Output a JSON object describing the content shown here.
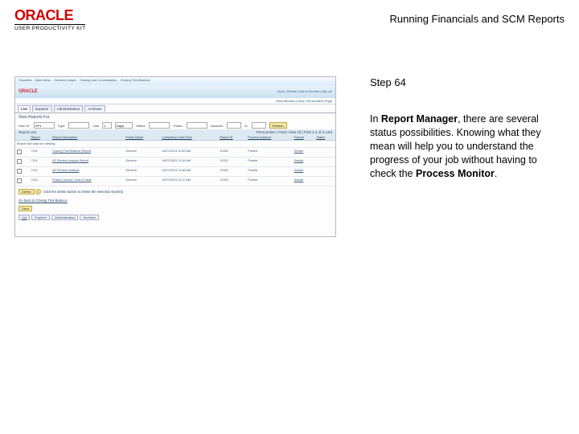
{
  "header": {
    "brand": "ORACLE",
    "brand_sub": "USER PRODUCTIVITY KIT",
    "doc_title": "Running Financials and SCM Reports"
  },
  "step": {
    "label": "Step 64"
  },
  "body": {
    "p1a": "In ",
    "p1b": "Report Manager",
    "p1c": ", there are several status possibilities. Knowing what they mean will help you to understand the progress of your job without having to check the ",
    "p1d": "Process Monitor",
    "p1e": "."
  },
  "ss": {
    "topnav": [
      "Favorites",
      "Main Menu",
      "General Ledger",
      "Closing and Consolidation",
      "Closing Trial Balance",
      "Home",
      "Worklist",
      "Add to Favorites",
      "Sign out"
    ],
    "brand": "ORACLE",
    "brand_right": "Home | Worklist | Add to Favorites | Sign out",
    "subtop": "New Window | Help | Personalize Page",
    "tabs": [
      "List",
      "Explorer",
      "Administration",
      "Archives"
    ],
    "section_title": "View Reports For",
    "filter": {
      "userid_lbl": "User ID:",
      "userid_val": "VP1",
      "type_lbl": "Type:",
      "type_val": "",
      "last_lbl": "Last",
      "last_val": "1",
      "days_val": "Days",
      "status_lbl": "Status:",
      "status_val": "",
      "folder_lbl": "Folder:",
      "folder_val": "",
      "instance_lbl": "Instance:",
      "instance_val": "",
      "to_lbl": "to:",
      "refresh": "Refresh"
    },
    "list_header_left": "Report List",
    "list_header_right": "Personalize | Find | View All | First 1-4 of 4 Last",
    "cols": [
      "",
      "Report",
      "Report Description",
      "Folder Name",
      "Completion Date/Time",
      "Report ID",
      "Process Instance",
      "Format",
      "Status",
      "Details"
    ],
    "rows": [
      {
        "c": [
          "",
          "",
          "",
          "Report Not Valid for Viewing",
          "",
          "",
          "",
          "",
          "",
          ""
        ]
      },
      {
        "c": [
          "",
          "1",
          "7151",
          "Closing Trial Balance Report",
          "General",
          "10/07/2013 11:40 AM",
          "10322",
          "Posted",
          "Details",
          ""
        ]
      },
      {
        "c": [
          "",
          "1",
          "7151",
          "AP Review Anaysis Report",
          "General",
          "10/07/2013 11:39 AM",
          "10321",
          "Posted",
          "Details",
          ""
        ]
      },
      {
        "c": [
          "",
          "1",
          "7151",
          "AP Review Analysis",
          "General",
          "10/07/2013 11:38 AM",
          "10320",
          "Posted",
          "Details",
          ""
        ]
      },
      {
        "c": [
          "",
          "1",
          "7151",
          "Posted Journal Control Table",
          "General",
          "10/07/2013 11:37 AM",
          "10319",
          "Posted",
          "Details",
          ""
        ]
      }
    ],
    "footer_note": "Click the delete button to delete the selected report(s)",
    "delete_btn": "Delete",
    "golink": "Go back to Closing Trial Balance",
    "save_btn": "Save",
    "bottom_tabs": [
      "List",
      "Explorer",
      "Administration",
      "Archives"
    ]
  }
}
